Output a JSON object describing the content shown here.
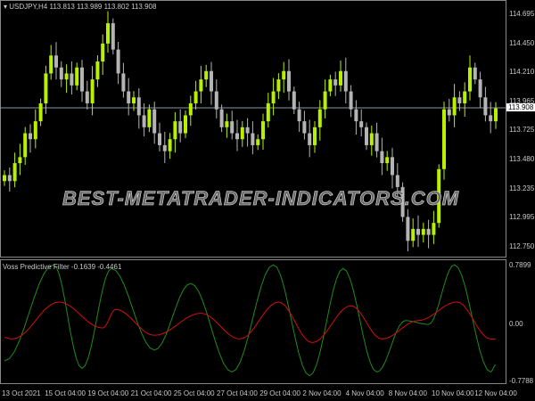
{
  "header": {
    "symbol": "USDJPY,H4",
    "ohlc": "113.813 113.989 113.802 113.908"
  },
  "price_axis": [
    "114.695",
    "114.450",
    "114.210",
    "113.965",
    "113.725",
    "113.480",
    "113.235",
    "112.995",
    "112.750"
  ],
  "current_price": "113.908",
  "indicator": {
    "title": "Voss Predictive Filter -0.1639 -0.4461",
    "axis": [
      "0.7899",
      "0.00",
      "-0.7788"
    ],
    "green_extremes": [
      [
        0,
        -0.5
      ],
      [
        9.5,
        0.8
      ],
      [
        15,
        -0.6
      ],
      [
        20.7,
        0.75
      ],
      [
        29,
        -0.35
      ],
      [
        36,
        0.55
      ],
      [
        44,
        -0.65
      ],
      [
        52,
        0.8
      ],
      [
        59,
        -0.7
      ],
      [
        65.5,
        0.75
      ],
      [
        72,
        -0.65
      ],
      [
        77.5,
        0.05
      ],
      [
        82,
        0.0
      ],
      [
        87,
        0.8
      ],
      [
        94,
        -0.65
      ],
      [
        95,
        -0.55
      ]
    ],
    "red_extremes": [
      [
        0,
        -0.18
      ],
      [
        1.5,
        -0.2
      ],
      [
        10.5,
        0.3
      ],
      [
        19,
        -0.05
      ],
      [
        21.5,
        0.2
      ],
      [
        29,
        -0.15
      ],
      [
        38,
        0.15
      ],
      [
        45.5,
        -0.2
      ],
      [
        53,
        0.3
      ],
      [
        59.5,
        -0.25
      ],
      [
        67,
        0.25
      ],
      [
        73,
        -0.2
      ],
      [
        80,
        0.05
      ],
      [
        87.5,
        0.3
      ],
      [
        94,
        -0.2
      ],
      [
        95,
        -0.2
      ]
    ],
    "colors": {
      "green": "#1e8c1e",
      "red": "#d01010"
    }
  },
  "time_axis": [
    "13 Oct 2021",
    "15 Oct 04:00",
    "19 Oct 04:00",
    "21 Oct 04:00",
    "25 Oct 04:00",
    "27 Oct 04:00",
    "29 Oct 04:00",
    "2 Nov 04:00",
    "4 Nov 04:00",
    "8 Nov 04:00",
    "10 Nov 04:00",
    "12 Nov 04:00"
  ],
  "watermark": "BEST-METATRADER-INDICATORS.COM",
  "colors": {
    "bull": "#b8f000",
    "bear": "#b4b4b4"
  },
  "closes": [
    113.35,
    113.3,
    113.45,
    113.5,
    113.7,
    113.65,
    113.8,
    113.95,
    114.2,
    114.35,
    114.25,
    114.15,
    114.2,
    114.1,
    114.25,
    114.05,
    113.95,
    114.15,
    114.3,
    114.45,
    114.62,
    114.4,
    114.2,
    114.05,
    113.95,
    114.0,
    113.85,
    113.75,
    113.9,
    113.7,
    113.6,
    113.55,
    113.65,
    113.8,
    113.7,
    113.85,
    113.95,
    114.05,
    114.15,
    114.22,
    114.05,
    113.9,
    113.75,
    113.8,
    113.7,
    113.65,
    113.75,
    113.7,
    113.6,
    113.65,
    113.8,
    113.95,
    114.05,
    114.15,
    114.22,
    114.05,
    113.9,
    113.8,
    113.7,
    113.6,
    113.75,
    113.9,
    114.05,
    114.15,
    114.1,
    114.22,
    114.05,
    113.9,
    113.8,
    113.75,
    113.6,
    113.7,
    113.55,
    113.45,
    113.5,
    113.35,
    113.25,
    113.0,
    112.8,
    112.9,
    112.85,
    112.9,
    112.85,
    112.95,
    113.4,
    113.9,
    113.85,
    114.0,
    113.95,
    114.05,
    114.25,
    114.15,
    114.0,
    113.85,
    113.8,
    113.908
  ]
}
